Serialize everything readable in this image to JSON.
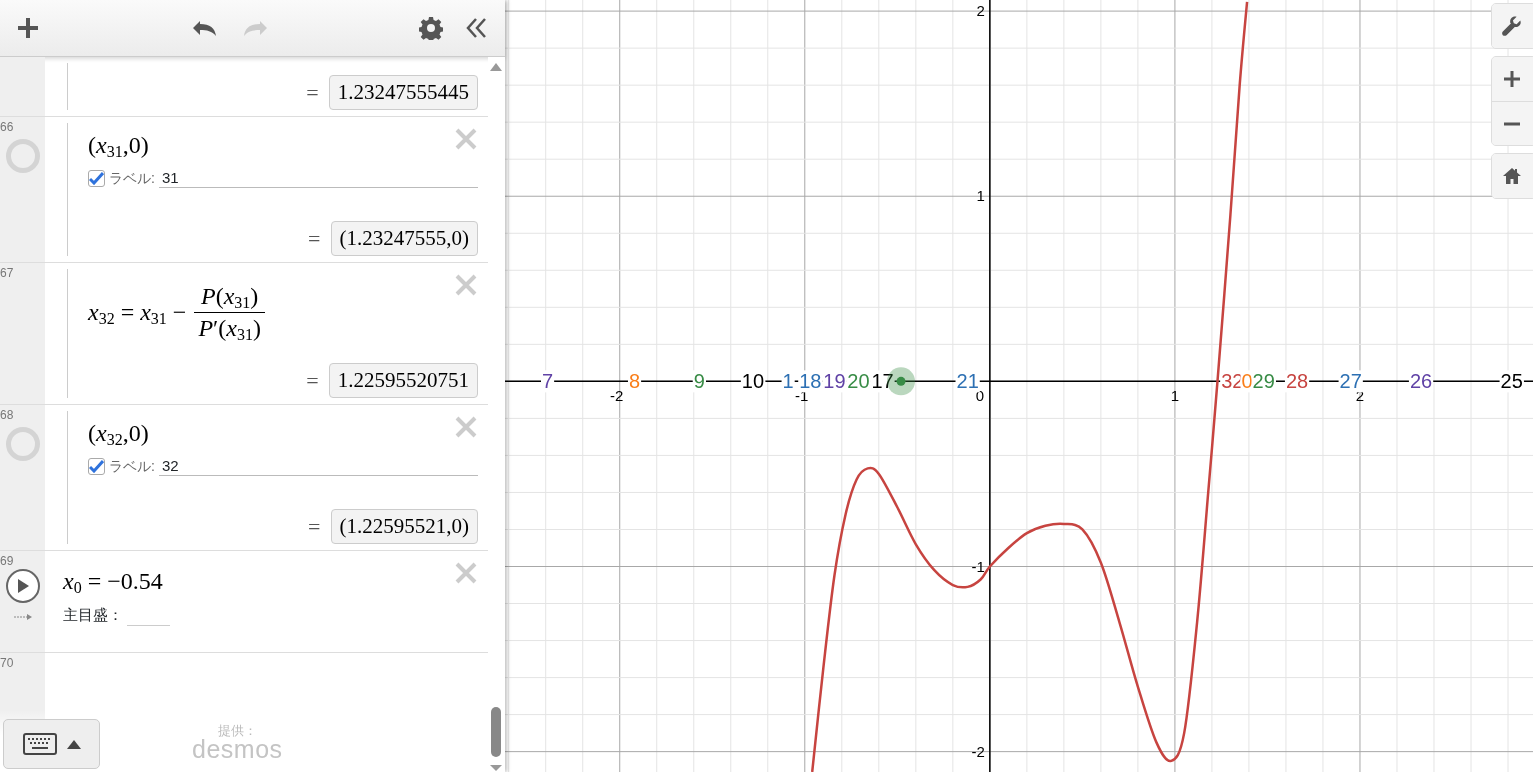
{
  "toolbar": {
    "buttons": [
      {
        "kind": "add",
        "disabled": false
      },
      {
        "kind": "undo",
        "disabled": false
      },
      {
        "kind": "redo",
        "disabled": true
      },
      {
        "kind": "settings",
        "disabled": false
      },
      {
        "kind": "collapse",
        "disabled": false
      }
    ]
  },
  "expressions": [
    {
      "kind": "folder",
      "children": [
        {
          "kind": "partial",
          "equals": "=",
          "result": "1.23247555445"
        },
        {
          "kind": "point",
          "number": "66",
          "math": "(*x*$_{31}$,0)",
          "label_checked": true,
          "label_caption": "ラベル:",
          "label_value": "31",
          "equals": "=",
          "result": "(1.23247555,0)"
        },
        {
          "kind": "formula",
          "number": "67",
          "lhs": "*x*$_{32}$ = *x*$_{31}$ −",
          "numerator": "*P*(*x*$_{31}$)",
          "denominator": "*P*′(*x*$_{31}$)",
          "equals": "=",
          "result": "1.22595520751"
        },
        {
          "kind": "point",
          "number": "68",
          "math": "(*x*$_{32}$,0)",
          "label_checked": true,
          "label_caption": "ラベル:",
          "label_value": "32",
          "equals": "=",
          "result": "(1.22595521,0)"
        }
      ]
    },
    {
      "kind": "slider",
      "number": "69",
      "math": "*x*$_{0}$ = −0.54",
      "step_caption": "主目盛："
    },
    {
      "kind": "empty",
      "number": "70"
    }
  ],
  "footer": {
    "credit": "提供：",
    "brand": "desmos"
  },
  "graph": {
    "chart_data": {
      "type": "line",
      "xlim": [
        -2.62,
        2.935
      ],
      "ylim": [
        -2.11,
        2.06
      ],
      "grid": true,
      "xticks": [
        -2,
        -1,
        1,
        2
      ],
      "yticks": [
        -2,
        -1,
        1,
        2
      ],
      "x": [
        -0.96,
        -0.9,
        -0.84,
        -0.78,
        -0.72,
        -0.66,
        -0.6,
        -0.5,
        -0.4,
        -0.3,
        -0.2,
        -0.12,
        -0.05,
        0,
        0.1,
        0.2,
        0.3,
        0.4,
        0.5,
        0.6,
        0.7,
        0.8,
        0.9,
        0.98,
        1.05,
        1.12,
        1.18,
        1.23,
        1.3,
        1.35,
        1.39
      ],
      "series": [
        {
          "color": "#c74440",
          "values": [
            -2.11,
            -1.55,
            -1.05,
            -0.72,
            -0.53,
            -0.47,
            -0.5,
            -0.68,
            -0.88,
            -1.02,
            -1.1,
            -1.11,
            -1.07,
            -1.0,
            -0.9,
            -0.82,
            -0.78,
            -0.77,
            -0.8,
            -0.98,
            -1.3,
            -1.65,
            -1.95,
            -2.05,
            -1.9,
            -1.3,
            -0.6,
            0,
            0.9,
            1.6,
            2.05
          ]
        }
      ]
    },
    "origin_label": "0",
    "highlighted_point": true,
    "point_labels": [
      {
        "text": "7",
        "color": "#6042a6"
      },
      {
        "text": "8",
        "color": "#fa7e19"
      },
      {
        "text": "9",
        "color": "#388c46"
      },
      {
        "text": "10",
        "color": "#000000"
      },
      {
        "text": "1",
        "color": "#2d70b3"
      },
      {
        "text": "18",
        "color": "#2d70b3"
      },
      {
        "text": "19",
        "color": "#6042a6"
      },
      {
        "text": "20",
        "color": "#388c46"
      },
      {
        "text": "17",
        "color": "#000000"
      },
      {
        "text": "21",
        "color": "#2d70b3"
      },
      {
        "text": "32",
        "color": "#c74440"
      },
      {
        "text": "0",
        "color": "#fa7e19"
      },
      {
        "text": "29",
        "color": "#388c46"
      },
      {
        "text": "28",
        "color": "#c74440"
      },
      {
        "text": "27",
        "color": "#2d70b3"
      },
      {
        "text": "26",
        "color": "#6042a6"
      },
      {
        "text": "25",
        "color": "#000000"
      }
    ]
  },
  "graph_controls": [
    {
      "kind": "settings"
    },
    {
      "kind": "zoom_in"
    },
    {
      "kind": "zoom_out"
    },
    {
      "kind": "home"
    }
  ]
}
